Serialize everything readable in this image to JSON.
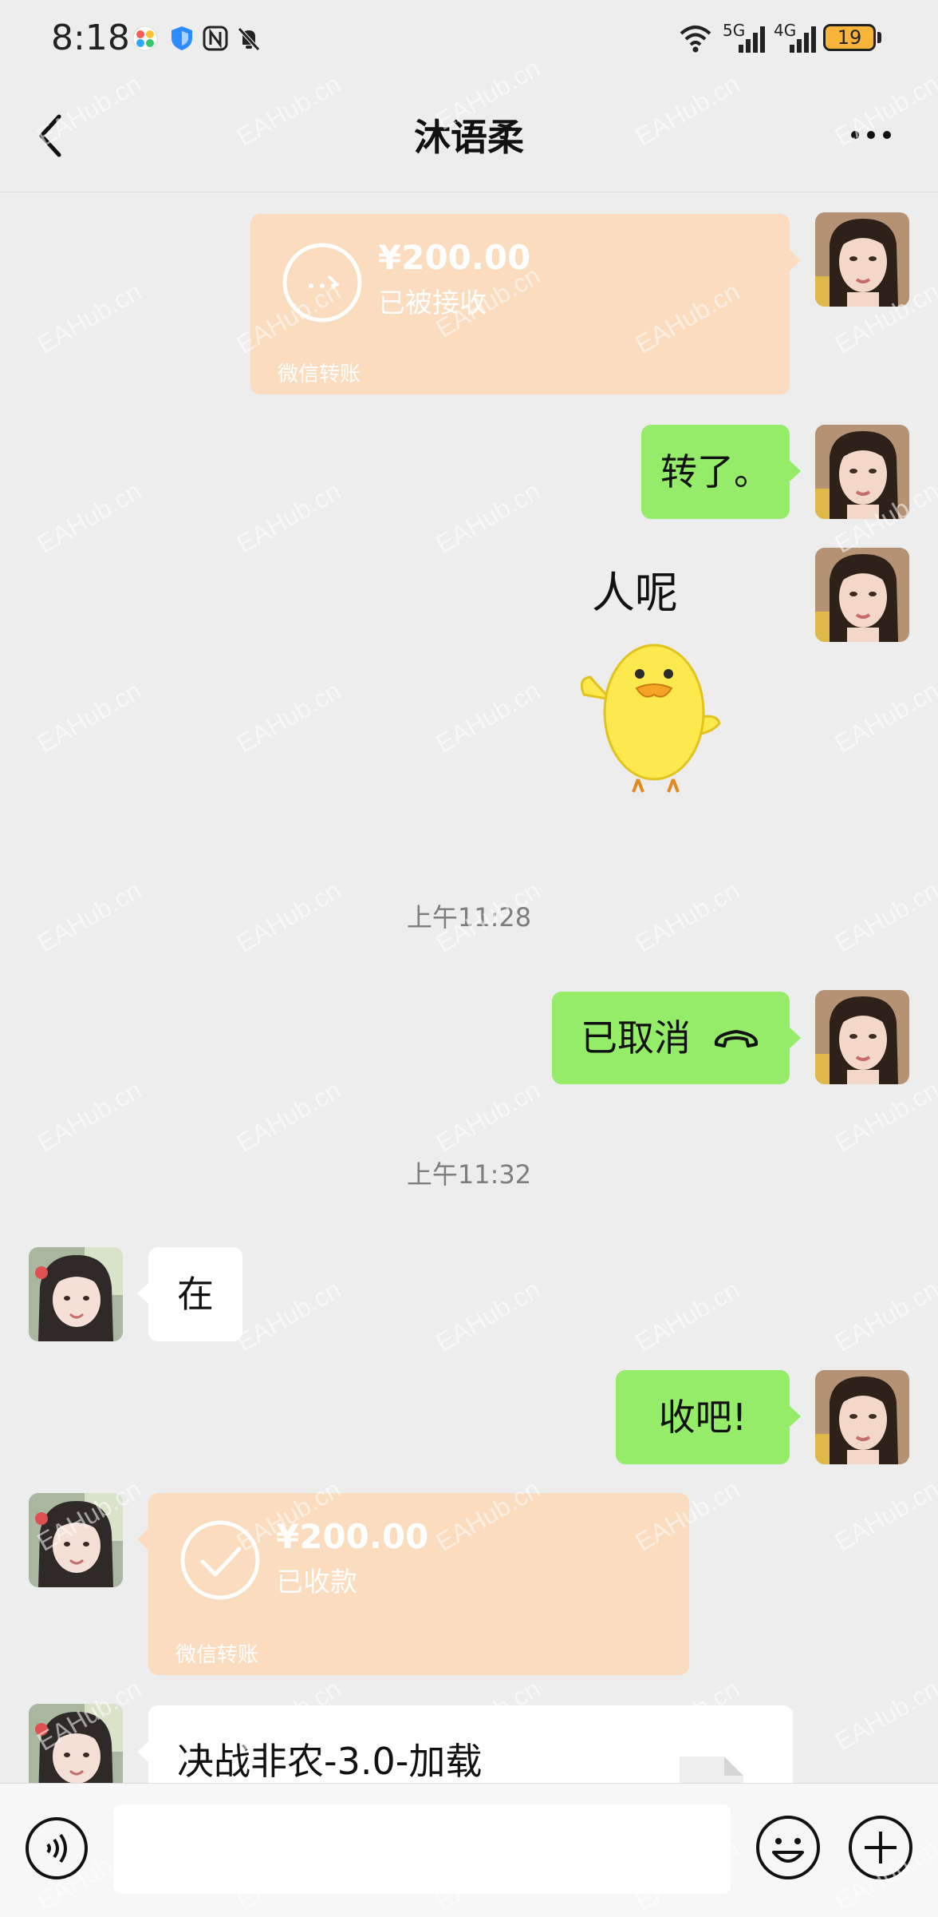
{
  "status_bar": {
    "time": "8:18",
    "net_5g": "5G",
    "net_4g": "4G",
    "battery": "19"
  },
  "header": {
    "title": "沐语柔"
  },
  "messages": {
    "m1": {
      "amount": "¥200.00",
      "status": "已被接收",
      "footer": "微信转账"
    },
    "m2": {
      "text": "转了。"
    },
    "m3": {
      "caption": "人呢"
    },
    "ts1": "上午11:28",
    "m4": {
      "text": "已取消"
    },
    "ts2": "上午11:32",
    "m5": {
      "text": "在"
    },
    "m6": {
      "text": "收吧!"
    },
    "m7": {
      "amount": "¥200.00",
      "status": "已收款",
      "footer": "微信转账"
    },
    "m8": {
      "text": "决战非农-3.0-加载"
    }
  },
  "watermark": "EAHub.cn",
  "colors": {
    "sent_bubble": "#95ec69",
    "received_bubble": "#ffffff",
    "transfer_card": "#fbdcbe",
    "background": "#ededed"
  }
}
